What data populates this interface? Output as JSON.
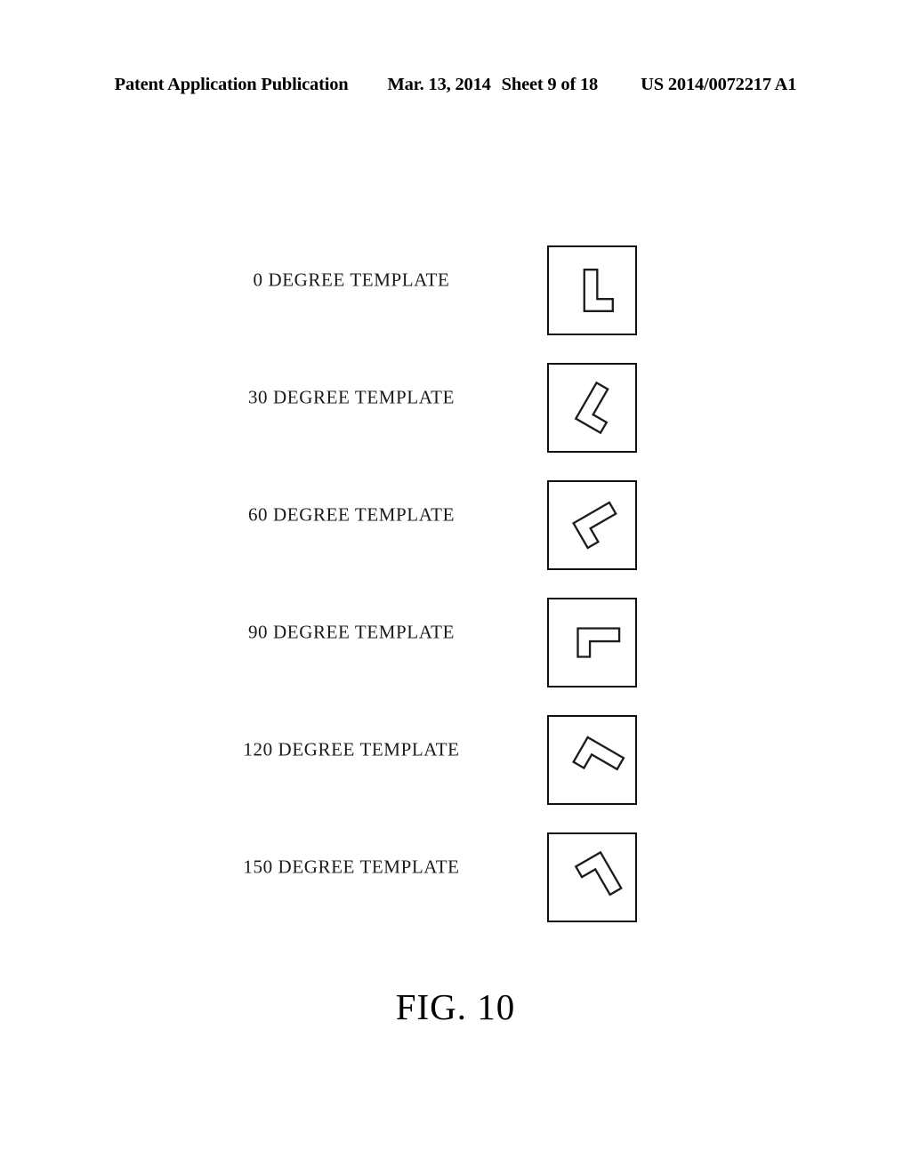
{
  "header": {
    "publication": "Patent Application Publication",
    "date": "Mar. 13, 2014",
    "sheet": "Sheet 9 of 18",
    "publication_number": "US 2014/0072217 A1"
  },
  "figure": {
    "caption": "FIG. 10",
    "shape_name": "l-shape-template",
    "box_border_color": "#111111",
    "shape_stroke_color": "#1c1c1c",
    "rows": [
      {
        "label": "0 DEGREE TEMPLATE",
        "angle": 0
      },
      {
        "label": "30 DEGREE TEMPLATE",
        "angle": 30
      },
      {
        "label": "60 DEGREE TEMPLATE",
        "angle": 60
      },
      {
        "label": "90 DEGREE TEMPLATE",
        "angle": 90
      },
      {
        "label": "120 DEGREE TEMPLATE",
        "angle": 120
      },
      {
        "label": "150 DEGREE TEMPLATE",
        "angle": 150
      }
    ]
  }
}
